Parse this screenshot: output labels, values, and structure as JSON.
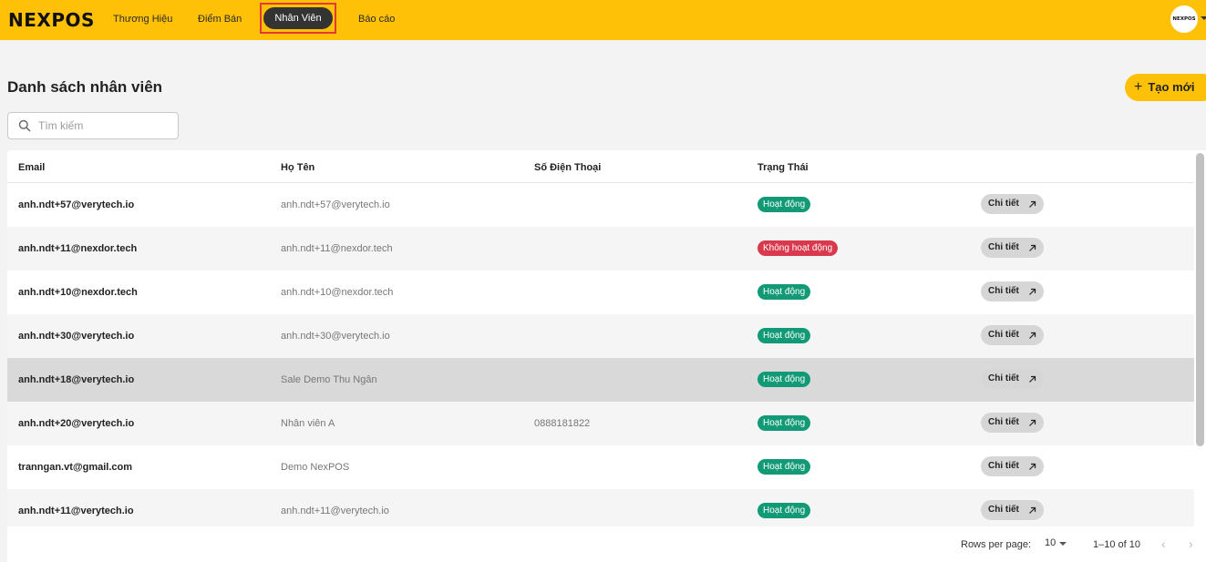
{
  "header": {
    "logo": "NEXPOS",
    "nav": [
      {
        "label": "Thương Hiệu"
      },
      {
        "label": "Điểm Bán"
      },
      {
        "label": "Nhân Viên"
      },
      {
        "label": "Báo cáo"
      }
    ],
    "active_index": 2,
    "avatar_text": "NEXPOS"
  },
  "page": {
    "title": "Danh sách nhân viên",
    "create_button": "Tạo mới",
    "search_placeholder": "Tìm kiếm"
  },
  "table": {
    "columns": [
      "Email",
      "Họ Tên",
      "Số Điện Thoại",
      "Trạng Thái"
    ],
    "detail_label": "Chi tiết",
    "rows": [
      {
        "email": "anh.ndt+57@verytech.io",
        "name": "anh.ndt+57@verytech.io",
        "phone": "",
        "status": "Hoạt động",
        "active": true
      },
      {
        "email": "anh.ndt+11@nexdor.tech",
        "name": "anh.ndt+11@nexdor.tech",
        "phone": "",
        "status": "Không hoạt động",
        "active": false
      },
      {
        "email": "anh.ndt+10@nexdor.tech",
        "name": "anh.ndt+10@nexdor.tech",
        "phone": "",
        "status": "Hoạt động",
        "active": true
      },
      {
        "email": "anh.ndt+30@verytech.io",
        "name": "anh.ndt+30@verytech.io",
        "phone": "",
        "status": "Hoạt động",
        "active": true
      },
      {
        "email": "anh.ndt+18@verytech.io",
        "name": "Sale Demo Thu Ngân",
        "phone": "",
        "status": "Hoạt động",
        "active": true,
        "highlighted": true
      },
      {
        "email": "anh.ndt+20@verytech.io",
        "name": "Nhân viên A",
        "phone": "0888181822",
        "status": "Hoạt động",
        "active": true
      },
      {
        "email": "tranngan.vt@gmail.com",
        "name": "Demo NexPOS",
        "phone": "",
        "status": "Hoạt động",
        "active": true
      },
      {
        "email": "anh.ndt+11@verytech.io",
        "name": "anh.ndt+11@verytech.io",
        "phone": "",
        "status": "Hoạt động",
        "active": true
      }
    ]
  },
  "pagination": {
    "rows_per_page_label": "Rows per page:",
    "rows_per_page": "10",
    "range": "1–10 of 10",
    "prev": "‹",
    "next": "›"
  },
  "colors": {
    "brand": "#ffc107",
    "active_badge": "#129a77",
    "inactive_badge": "#d9394c"
  }
}
